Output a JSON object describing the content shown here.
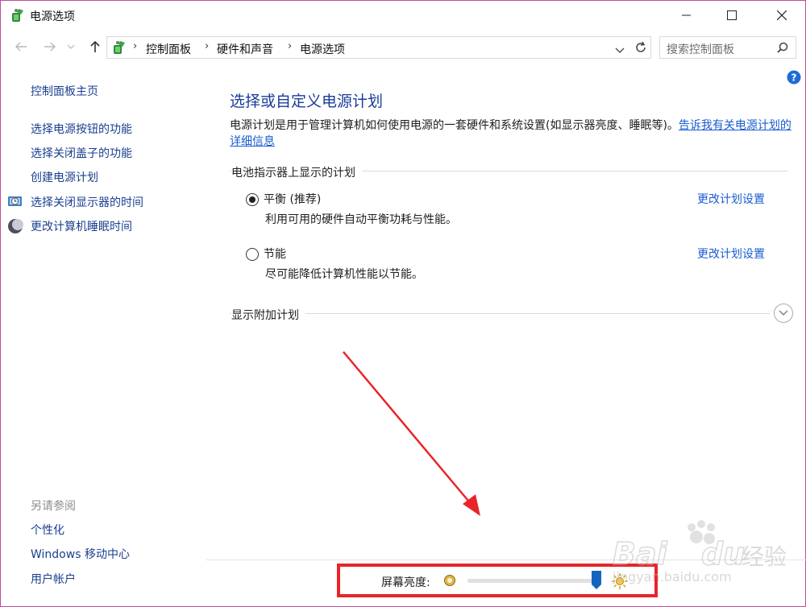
{
  "window": {
    "title": "电源选项",
    "controls": [
      "minimize",
      "maximize",
      "close"
    ]
  },
  "address_bar": {
    "breadcrumbs": [
      "控制面板",
      "硬件和声音",
      "电源选项"
    ],
    "search_placeholder": "搜索控制面板"
  },
  "sidebar": {
    "home_link": "控制面板主页",
    "tasks": [
      {
        "label": "选择电源按钮的功能",
        "icon": ""
      },
      {
        "label": "选择关闭盖子的功能",
        "icon": ""
      },
      {
        "label": "创建电源计划",
        "icon": ""
      },
      {
        "label": "选择关闭显示器的时间",
        "icon": "monitor-clock-icon"
      },
      {
        "label": "更改计算机睡眠时间",
        "icon": "moon-icon"
      }
    ],
    "see_also_title": "另请参阅",
    "see_also": [
      "个性化",
      "Windows 移动中心",
      "用户帐户"
    ]
  },
  "main": {
    "heading": "选择或自定义电源计划",
    "description": "电源计划是用于管理计算机如何使用电源的一套硬件和系统设置(如显示器亮度、睡眠等)。",
    "description_link": "告诉我有关电源计划的详细信息",
    "battery_group_label": "电池指示器上显示的计划",
    "plans": [
      {
        "name": "平衡 (推荐)",
        "description": "利用可用的硬件自动平衡功耗与性能。",
        "selected": true,
        "action": "更改计划设置"
      },
      {
        "name": "节能",
        "description": "尽可能降低计算机性能以节能。",
        "selected": false,
        "action": "更改计划设置"
      }
    ],
    "additional_plans_label": "显示附加计划"
  },
  "brightness": {
    "label": "屏幕亮度:",
    "level": 1.0
  },
  "colors": {
    "link": "#1a3f8f",
    "heading": "#1a3d9b",
    "highlight_box": "#e8242a",
    "arrow": "#e8242a",
    "slider_thumb": "#1565c0"
  },
  "watermark": {
    "text": "Bai du 经验",
    "subtext": "jingyan.baidu.com"
  }
}
